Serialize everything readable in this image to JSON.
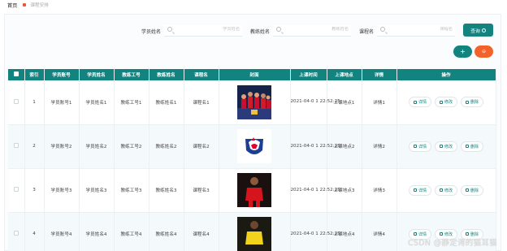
{
  "breadcrumb": {
    "home": "首页",
    "current": "课程安排"
  },
  "search": {
    "fields": [
      {
        "label": "学员姓名",
        "placeholder": "学员姓名"
      },
      {
        "label": "教练姓名",
        "placeholder": "教练姓名"
      },
      {
        "label": "课程名",
        "placeholder": "课程名"
      }
    ],
    "query_label": "查询"
  },
  "toolbar": {
    "add_label": "+",
    "delete_label": "⊖"
  },
  "table": {
    "headers": [
      "索引",
      "学员账号",
      "学员姓名",
      "教练工号",
      "教练姓名",
      "课程名",
      "封面",
      "上课时间",
      "上课地点",
      "详情",
      "操作"
    ],
    "rows": [
      {
        "index": "1",
        "student_account": "学员账号1",
        "student_name": "学员姓名1",
        "coach_id": "教练工号1",
        "coach_name": "教练姓名1",
        "course": "课程名1",
        "cover": "team-celebration",
        "time": "2021-04-0 1 22:52:25",
        "place": "上课地点1",
        "detail": "详情1"
      },
      {
        "index": "2",
        "student_account": "学员账号2",
        "student_name": "学员姓名2",
        "coach_id": "教练工号2",
        "coach_name": "教练姓名2",
        "course": "课程名2",
        "cover": "rooster-logo",
        "time": "2021-04-0 1 22:52:25",
        "place": "上课地点2",
        "detail": "详情2"
      },
      {
        "index": "3",
        "student_account": "学员账号3",
        "student_name": "学员姓名3",
        "coach_id": "教练工号3",
        "coach_name": "教练姓名3",
        "course": "课程名3",
        "cover": "player-red",
        "time": "2021-04-0 1 22:52:25",
        "place": "上课地点3",
        "detail": "详情3"
      },
      {
        "index": "4",
        "student_account": "学员账号4",
        "student_name": "学员姓名4",
        "coach_id": "教练工号4",
        "coach_name": "教练姓名4",
        "course": "课程名4",
        "cover": "player-yellow",
        "time": "2021-04-0 1 22:52:25",
        "place": "上课地点4",
        "detail": "详情4"
      }
    ],
    "actions": {
      "detail": "详情",
      "edit": "修改",
      "delete": "删除"
    }
  },
  "watermark": "CSDN @静定谔的猫耳猫",
  "colors": {
    "primary": "#138380",
    "danger": "#f2622a"
  }
}
